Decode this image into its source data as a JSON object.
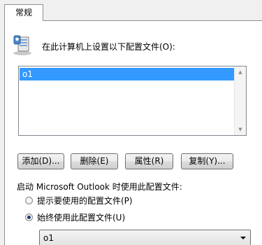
{
  "tab": {
    "label": "常规"
  },
  "header": {
    "label": "在此计算机上设置以下配置文件(O):",
    "icon": "profile-icon"
  },
  "profiles": {
    "items": [
      "o1"
    ],
    "selected": "o1"
  },
  "buttons": {
    "add": "添加(D)...",
    "remove": "删除(E)",
    "properties": "属性(R)",
    "copy": "复制(Y)..."
  },
  "startup": {
    "label": "启动 Microsoft Outlook 时使用此配置文件:",
    "prompt_option": "提示要使用的配置文件(P)",
    "always_option": "始终使用此配置文件(U)",
    "selected_option": "always",
    "always_value": "o1"
  },
  "colors": {
    "selection": "#3399ff",
    "border": "#8e8f8f"
  }
}
